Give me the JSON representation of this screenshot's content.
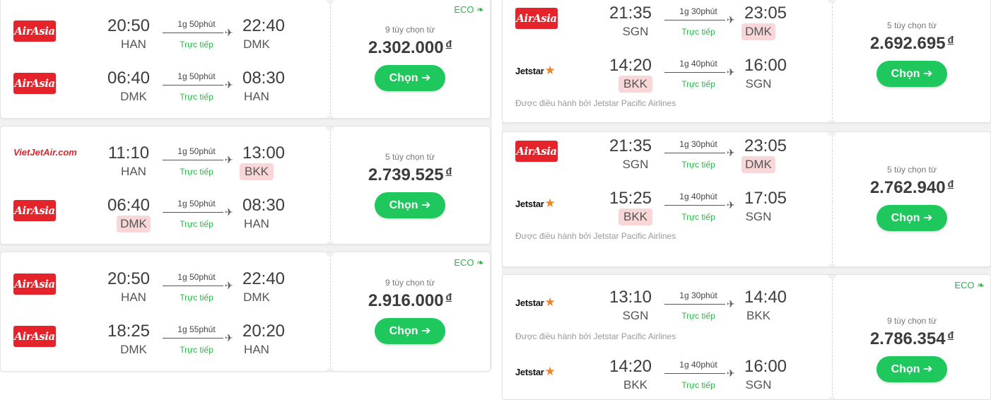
{
  "labels": {
    "choose": "Chọn",
    "eco": "ECO",
    "currency": "đ",
    "direct": "Trực tiếp",
    "operator_prefix": "Được điều hành bởi"
  },
  "left_cards": [
    {
      "eco": true,
      "options": "9 tùy chọn từ",
      "price": "2.302.000",
      "legs": [
        {
          "airline": "AirAsia",
          "dep_time": "20:50",
          "dep_code": "HAN",
          "dep_warn": false,
          "duration": "1g 50phút",
          "stops": "Trực tiếp",
          "arr_time": "22:40",
          "arr_code": "DMK",
          "arr_warn": false
        },
        {
          "airline": "AirAsia",
          "dep_time": "06:40",
          "dep_code": "DMK",
          "dep_warn": false,
          "duration": "1g 50phút",
          "stops": "Trực tiếp",
          "arr_time": "08:30",
          "arr_code": "HAN",
          "arr_warn": false
        }
      ]
    },
    {
      "eco": false,
      "options": "5 tùy chọn từ",
      "price": "2.739.525",
      "legs": [
        {
          "airline": "VietJetAir.com",
          "dep_time": "11:10",
          "dep_code": "HAN",
          "dep_warn": false,
          "duration": "1g 50phút",
          "stops": "Trực tiếp",
          "arr_time": "13:00",
          "arr_code": "BKK",
          "arr_warn": true
        },
        {
          "airline": "AirAsia",
          "dep_time": "06:40",
          "dep_code": "DMK",
          "dep_warn": true,
          "duration": "1g 50phút",
          "stops": "Trực tiếp",
          "arr_time": "08:30",
          "arr_code": "HAN",
          "arr_warn": false
        }
      ]
    },
    {
      "eco": true,
      "options": "9 tùy chọn từ",
      "price": "2.916.000",
      "legs": [
        {
          "airline": "AirAsia",
          "dep_time": "20:50",
          "dep_code": "HAN",
          "dep_warn": false,
          "duration": "1g 50phút",
          "stops": "Trực tiếp",
          "arr_time": "22:40",
          "arr_code": "DMK",
          "arr_warn": false
        },
        {
          "airline": "AirAsia",
          "dep_time": "18:25",
          "dep_code": "DMK",
          "dep_warn": false,
          "duration": "1g 55phút",
          "stops": "Trực tiếp",
          "arr_time": "20:20",
          "arr_code": "HAN",
          "arr_warn": false
        }
      ]
    }
  ],
  "right_cards": [
    {
      "eco": false,
      "options": "5 tùy chọn từ",
      "price": "2.692.695",
      "legs": [
        {
          "airline": "AirAsia",
          "dep_time": "21:35",
          "dep_code": "SGN",
          "dep_warn": false,
          "duration": "1g 30phút",
          "stops": "Trực tiếp",
          "arr_time": "23:05",
          "arr_code": "DMK",
          "arr_warn": true
        },
        {
          "airline": "Jetstar",
          "dep_time": "14:20",
          "dep_code": "BKK",
          "dep_warn": true,
          "duration": "1g 40phút",
          "stops": "Trực tiếp",
          "arr_time": "16:00",
          "arr_code": "SGN",
          "arr_warn": false
        }
      ],
      "operator": "Được điều hành bởi Jetstar Pacific Airlines"
    },
    {
      "eco": false,
      "options": "5 tùy chọn từ",
      "price": "2.762.940",
      "legs": [
        {
          "airline": "AirAsia",
          "dep_time": "21:35",
          "dep_code": "SGN",
          "dep_warn": false,
          "duration": "1g 30phút",
          "stops": "Trực tiếp",
          "arr_time": "23:05",
          "arr_code": "DMK",
          "arr_warn": true
        },
        {
          "airline": "Jetstar",
          "dep_time": "15:25",
          "dep_code": "BKK",
          "dep_warn": true,
          "duration": "1g 40phút",
          "stops": "Trực tiếp",
          "arr_time": "17:05",
          "arr_code": "SGN",
          "arr_warn": false
        }
      ],
      "operator": "Được điều hành bởi Jetstar Pacific Airlines"
    },
    {
      "eco": true,
      "options": "9 tùy chọn từ",
      "price": "2.786.354",
      "legs": [
        {
          "airline": "Jetstar",
          "dep_time": "13:10",
          "dep_code": "SGN",
          "dep_warn": false,
          "duration": "1g 30phút",
          "stops": "Trực tiếp",
          "arr_time": "14:40",
          "arr_code": "BKK",
          "arr_warn": false
        },
        {
          "airline": "Jetstar",
          "dep_time": "14:20",
          "dep_code": "BKK",
          "dep_warn": false,
          "duration": "1g 40phút",
          "stops": "Trực tiếp",
          "arr_time": "16:00",
          "arr_code": "SGN",
          "arr_warn": false
        }
      ],
      "operator": "Được điều hành bởi Jetstar Pacific Airlines",
      "operator_after_leg": 0
    }
  ]
}
